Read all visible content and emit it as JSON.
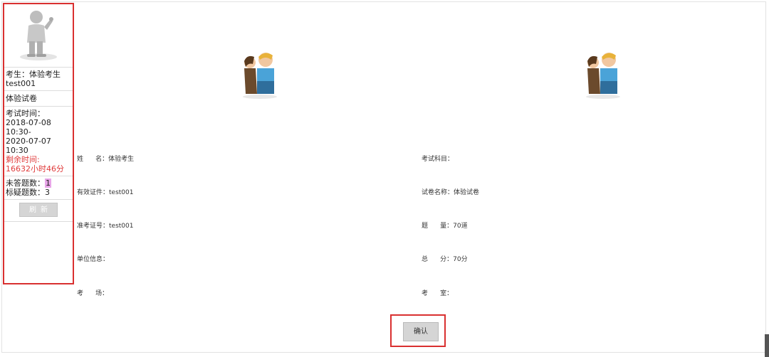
{
  "sidebar": {
    "candidate_line1": "考生：体验考生",
    "candidate_line2": "test001",
    "paper": "体验试卷",
    "exam_time_label": "考试时间：",
    "exam_time_start": "2018-07-08 10:30-",
    "exam_time_end": "2020-07-07 10:30",
    "remaining_label": "剩余时间:",
    "remaining_value": "16632小时46分",
    "unanswered_label": "未答题数：",
    "unanswered_value": "1",
    "flagged_label": "标疑题数：",
    "flagged_value": "3",
    "refresh_label": "刷新"
  },
  "info": {
    "name": "姓      名：体验考生",
    "subject": "考试科目：",
    "id_doc": "有效证件：test001",
    "paper_name": "试卷名称：体验试卷",
    "ticket": "准考证号：test001",
    "question_count": "题      量：70道",
    "unit": "单位信息：",
    "total_score": "总      分：70分",
    "venue": "考      场：",
    "room": "考      室："
  },
  "confirm_label": "确认",
  "colors": {
    "highlight_border": "#d93030",
    "remaining_text": "#e03b3b",
    "button_gray": "#d5d5d5"
  }
}
